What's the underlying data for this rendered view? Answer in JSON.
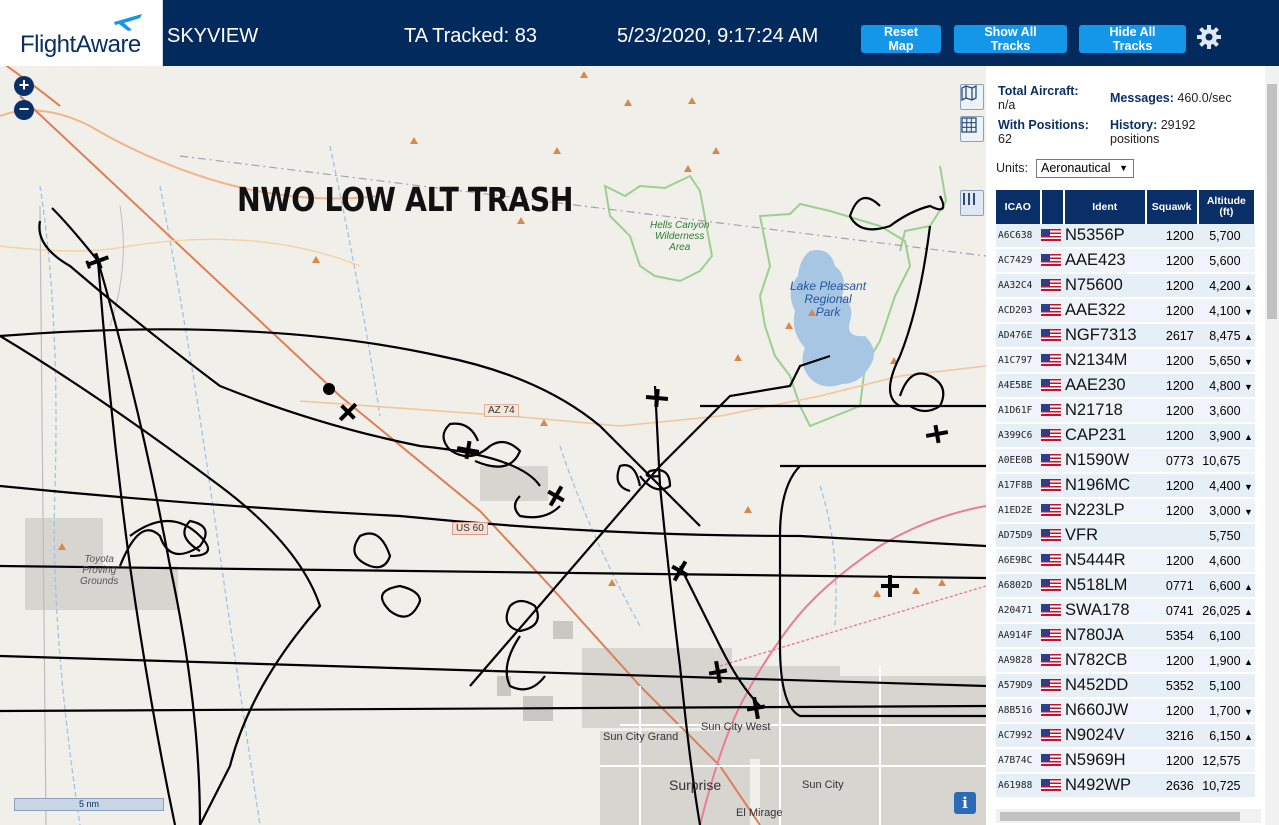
{
  "header": {
    "logo": "FlightAware",
    "title": "SKYVIEW",
    "tracked": "TA Tracked: 83",
    "time": "5/23/2020, 9:17:24 AM",
    "buttons": {
      "reset": "Reset Map",
      "show": "Show All Tracks",
      "hide": "Hide All Tracks"
    }
  },
  "map": {
    "overlay_text": "NWO LOW ALT TRASH",
    "zoom_in": "+",
    "zoom_out": "−",
    "scale": "5 nm",
    "info": "i",
    "labels": {
      "hells_canyon": "Hells Canyon\nWilderness\nArea",
      "lake_pleasant": "Lake Pleasant\nRegional\nPark",
      "yuma": "Toyota\nProving\nGrounds",
      "az74": "AZ 74",
      "us60": "US 60",
      "sun_city_grand": "Sun City Grand",
      "sun_city_west": "Sun City West",
      "surprise": "Surprise",
      "sun_city": "Sun City",
      "el_mirage": "El Mirage"
    }
  },
  "sidebar": {
    "total_aircraft_label": "Total Aircraft:",
    "total_aircraft_value": "n/a",
    "with_positions_label": "With Positions:",
    "with_positions_value": "62",
    "messages_label": "Messages:",
    "messages_value": "460.0/sec",
    "history_label": "History:",
    "history_value": "29192",
    "history_unit": "positions",
    "units_label": "Units:",
    "units_value": "Aeronautical",
    "columns": {
      "icao": "ICAO",
      "ident": "Ident",
      "squawk": "Squawk",
      "altitude": "Altitude",
      "altitude_unit": "(ft)"
    },
    "rows": [
      {
        "icao": "A6C638",
        "ident": "N5356P",
        "squawk": "1200",
        "alt": "5,700",
        "trend": ""
      },
      {
        "icao": "AC7429",
        "ident": "AAE423",
        "squawk": "1200",
        "alt": "5,600",
        "trend": ""
      },
      {
        "icao": "AA32C4",
        "ident": "N75600",
        "squawk": "1200",
        "alt": "4,200",
        "trend": "▲"
      },
      {
        "icao": "ACD203",
        "ident": "AAE322",
        "squawk": "1200",
        "alt": "4,100",
        "trend": "▼"
      },
      {
        "icao": "AD476E",
        "ident": "NGF7313",
        "squawk": "2617",
        "alt": "8,475",
        "trend": "▲"
      },
      {
        "icao": "A1C797",
        "ident": "N2134M",
        "squawk": "1200",
        "alt": "5,650",
        "trend": "▼"
      },
      {
        "icao": "A4E5BE",
        "ident": "AAE230",
        "squawk": "1200",
        "alt": "4,800",
        "trend": "▼"
      },
      {
        "icao": "A1D61F",
        "ident": "N21718",
        "squawk": "1200",
        "alt": "3,600",
        "trend": ""
      },
      {
        "icao": "A399C6",
        "ident": "CAP231",
        "squawk": "1200",
        "alt": "3,900",
        "trend": "▲"
      },
      {
        "icao": "A0EE0B",
        "ident": "N1590W",
        "squawk": "0773",
        "alt": "10,675",
        "trend": ""
      },
      {
        "icao": "A17F8B",
        "ident": "N196MC",
        "squawk": "1200",
        "alt": "4,400",
        "trend": "▼"
      },
      {
        "icao": "A1ED2E",
        "ident": "N223LP",
        "squawk": "1200",
        "alt": "3,000",
        "trend": "▼"
      },
      {
        "icao": "AD75D9",
        "ident": "VFR",
        "squawk": "",
        "alt": "5,750",
        "trend": ""
      },
      {
        "icao": "A6E9BC",
        "ident": "N5444R",
        "squawk": "1200",
        "alt": "4,600",
        "trend": ""
      },
      {
        "icao": "A6802D",
        "ident": "N518LM",
        "squawk": "0771",
        "alt": "6,600",
        "trend": "▲"
      },
      {
        "icao": "A20471",
        "ident": "SWA178",
        "squawk": "0741",
        "alt": "26,025",
        "trend": "▲"
      },
      {
        "icao": "AA914F",
        "ident": "N780JA",
        "squawk": "5354",
        "alt": "6,100",
        "trend": ""
      },
      {
        "icao": "AA9828",
        "ident": "N782CB",
        "squawk": "1200",
        "alt": "1,900",
        "trend": "▲"
      },
      {
        "icao": "A579D9",
        "ident": "N452DD",
        "squawk": "5352",
        "alt": "5,100",
        "trend": ""
      },
      {
        "icao": "A8B516",
        "ident": "N660JW",
        "squawk": "1200",
        "alt": "1,700",
        "trend": "▼"
      },
      {
        "icao": "AC7992",
        "ident": "N9024V",
        "squawk": "3216",
        "alt": "6,150",
        "trend": "▲"
      },
      {
        "icao": "A7B74C",
        "ident": "N5969H",
        "squawk": "1200",
        "alt": "12,575",
        "trend": ""
      },
      {
        "icao": "A61988",
        "ident": "N492WP",
        "squawk": "2636",
        "alt": "10,725",
        "trend": ""
      }
    ]
  }
}
